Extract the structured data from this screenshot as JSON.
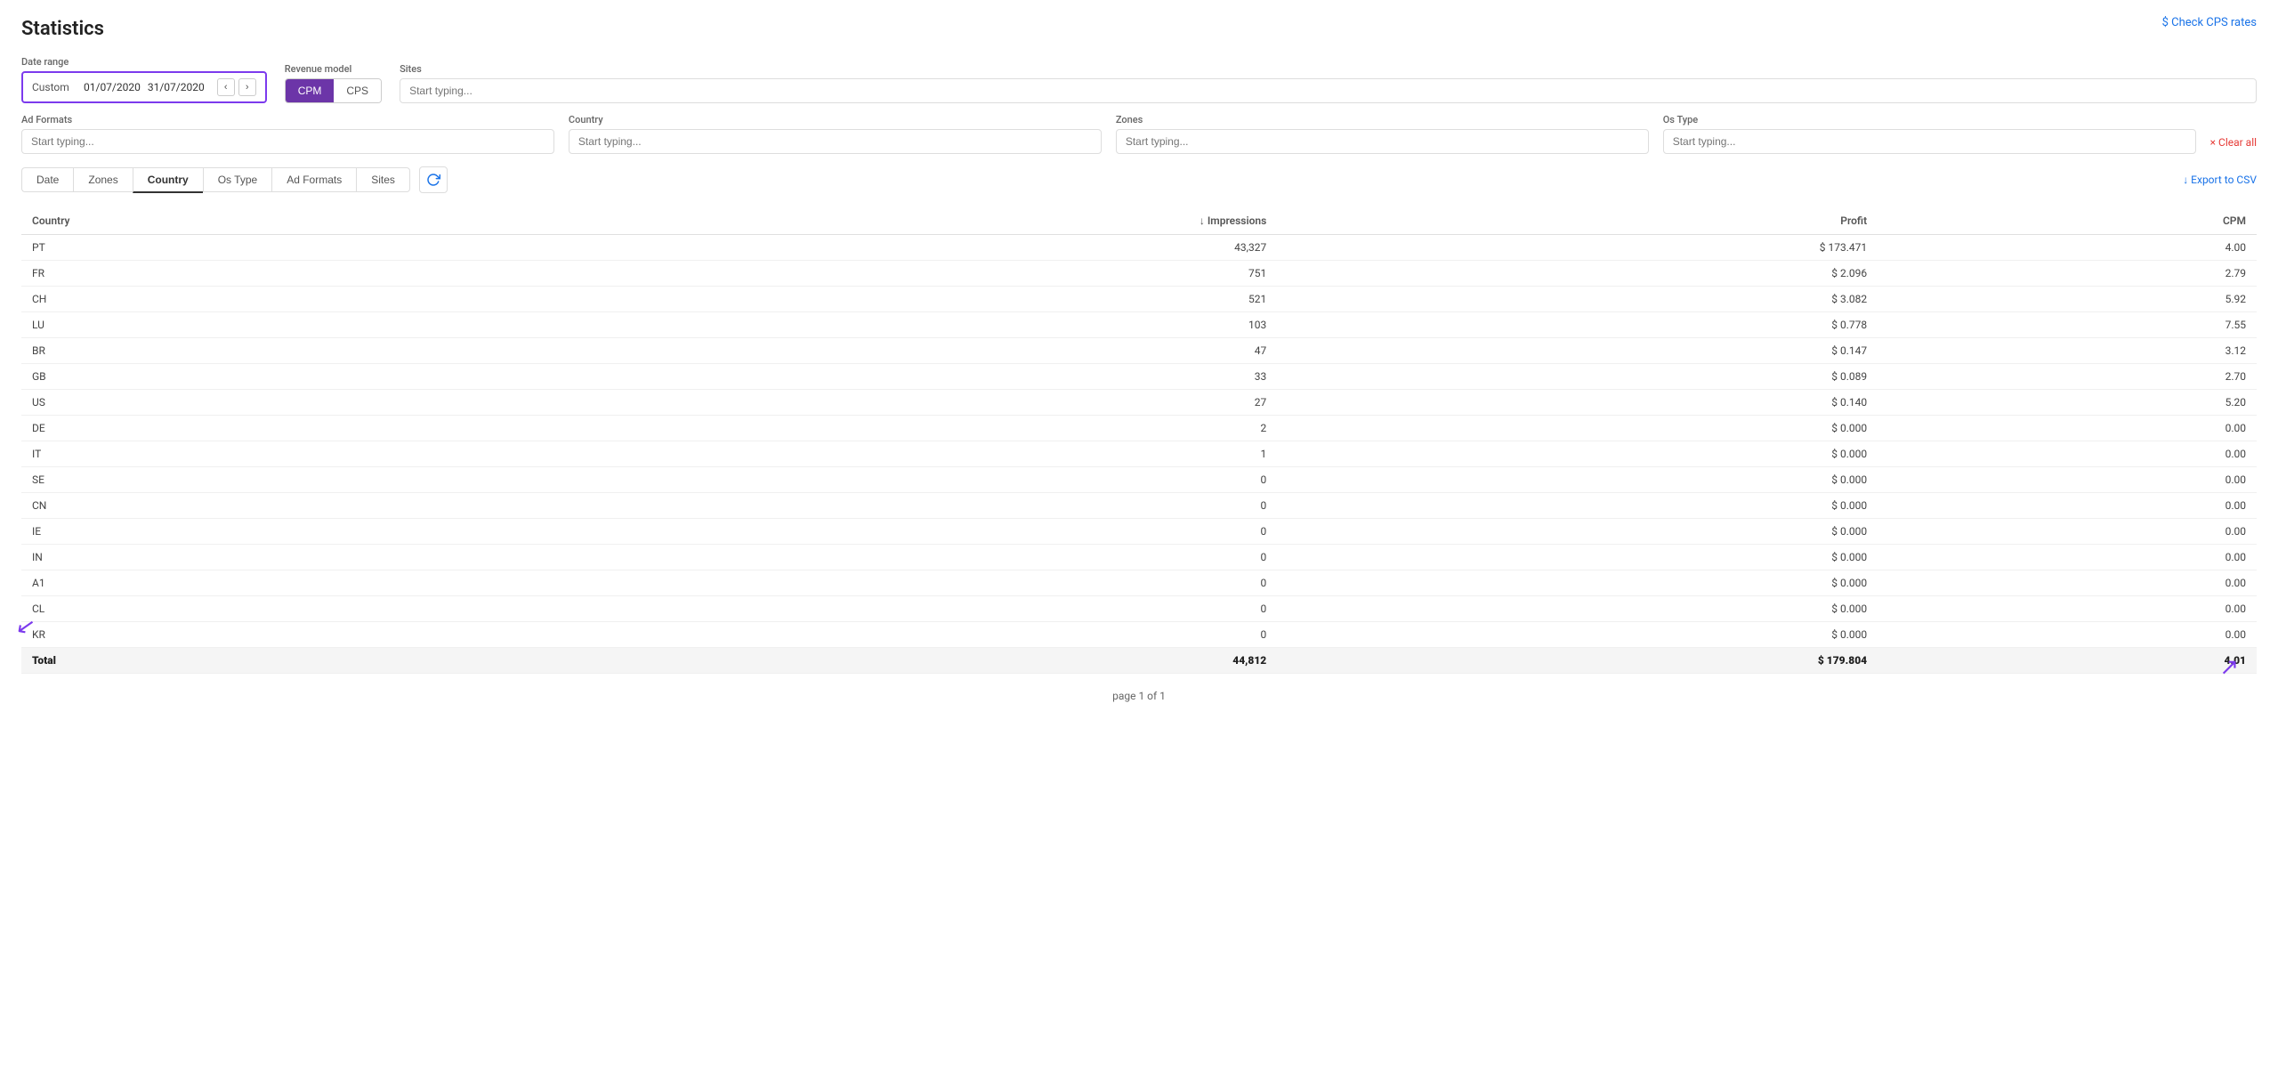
{
  "page": {
    "title": "Statistics",
    "check_cps_label": "$ Check CPS rates"
  },
  "filters": {
    "date_range": {
      "label": "Date range",
      "type": "Custom",
      "start": "01/07/2020",
      "end": "31/07/2020"
    },
    "revenue_model": {
      "label": "Revenue model",
      "options": [
        "CPM",
        "CPS"
      ],
      "active": "CPM"
    },
    "sites": {
      "label": "Sites",
      "placeholder": "Start typing..."
    },
    "ad_formats": {
      "label": "Ad Formats",
      "placeholder": "Start typing..."
    },
    "country": {
      "label": "Country",
      "placeholder": "Start typing..."
    },
    "zones": {
      "label": "Zones",
      "placeholder": "Start typing..."
    },
    "os_type": {
      "label": "Os Type",
      "placeholder": "Start typing..."
    },
    "clear_all_label": "× Clear all"
  },
  "tabs": [
    {
      "id": "date",
      "label": "Date"
    },
    {
      "id": "zones",
      "label": "Zones"
    },
    {
      "id": "country",
      "label": "Country",
      "active": true
    },
    {
      "id": "os-type",
      "label": "Os Type"
    },
    {
      "id": "ad-formats",
      "label": "Ad Formats"
    },
    {
      "id": "sites",
      "label": "Sites"
    }
  ],
  "export_label": "↓ Export to CSV",
  "table": {
    "columns": [
      {
        "id": "country",
        "label": "Country",
        "align": "left"
      },
      {
        "id": "impressions",
        "label": "↓ Impressions",
        "align": "right"
      },
      {
        "id": "profit",
        "label": "Profit",
        "align": "right"
      },
      {
        "id": "cpm",
        "label": "CPM",
        "align": "right"
      }
    ],
    "rows": [
      {
        "country": "PT",
        "impressions": "43,327",
        "profit": "$ 173.471",
        "cpm": "4.00"
      },
      {
        "country": "FR",
        "impressions": "751",
        "profit": "$ 2.096",
        "cpm": "2.79"
      },
      {
        "country": "CH",
        "impressions": "521",
        "profit": "$ 3.082",
        "cpm": "5.92"
      },
      {
        "country": "LU",
        "impressions": "103",
        "profit": "$ 0.778",
        "cpm": "7.55"
      },
      {
        "country": "BR",
        "impressions": "47",
        "profit": "$ 0.147",
        "cpm": "3.12"
      },
      {
        "country": "GB",
        "impressions": "33",
        "profit": "$ 0.089",
        "cpm": "2.70"
      },
      {
        "country": "US",
        "impressions": "27",
        "profit": "$ 0.140",
        "cpm": "5.20"
      },
      {
        "country": "DE",
        "impressions": "2",
        "profit": "$ 0.000",
        "cpm": "0.00"
      },
      {
        "country": "IT",
        "impressions": "1",
        "profit": "$ 0.000",
        "cpm": "0.00"
      },
      {
        "country": "SE",
        "impressions": "0",
        "profit": "$ 0.000",
        "cpm": "0.00"
      },
      {
        "country": "CN",
        "impressions": "0",
        "profit": "$ 0.000",
        "cpm": "0.00"
      },
      {
        "country": "IE",
        "impressions": "0",
        "profit": "$ 0.000",
        "cpm": "0.00"
      },
      {
        "country": "IN",
        "impressions": "0",
        "profit": "$ 0.000",
        "cpm": "0.00"
      },
      {
        "country": "A1",
        "impressions": "0",
        "profit": "$ 0.000",
        "cpm": "0.00"
      },
      {
        "country": "CL",
        "impressions": "0",
        "profit": "$ 0.000",
        "cpm": "0.00"
      },
      {
        "country": "KR",
        "impressions": "0",
        "profit": "$ 0.000",
        "cpm": "0.00"
      }
    ],
    "footer": {
      "label": "Total",
      "impressions": "44,812",
      "profit": "$ 179.804",
      "cpm": "4.01"
    }
  },
  "pagination": {
    "text": "page 1 of 1"
  }
}
